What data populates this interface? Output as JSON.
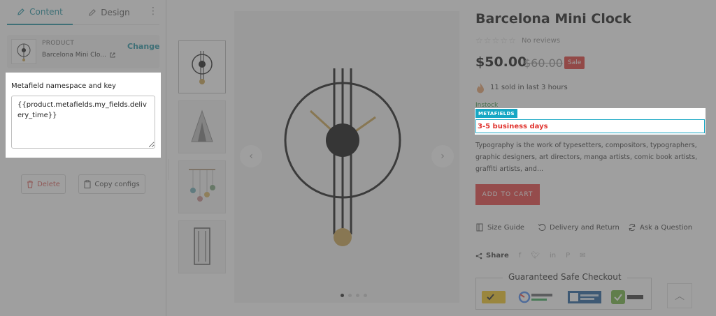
{
  "editor": {
    "tabs": [
      {
        "label": "Content",
        "active": true
      },
      {
        "label": "Design",
        "active": false
      }
    ],
    "more_icon": "more-vertical-icon",
    "product_card": {
      "caption": "PRODUCT",
      "name": "Barcelona Mini Clo...",
      "change_label": "Change"
    },
    "metafield": {
      "label": "Metafield namespace and key",
      "value": "{{product.metafields.my_fields.delivery_time}}"
    },
    "delete_label": "Delete",
    "copy_label": "Copy configs"
  },
  "product": {
    "title": "Barcelona Mini Clock",
    "reviews": "No reviews",
    "rating": 0,
    "rating_max": 5,
    "price": "$50.00",
    "compare_price": "$60.00",
    "sale_label": "Sale",
    "sold_text": "11 sold in last 3 hours",
    "stock_text": "Instock",
    "metafield_badge": "METAFIELDS",
    "metafield_value": "3-5 business days",
    "description": "Typography is the work of typesetters, compositors, typographers, graphic designers, art directors, manga artists, comic book artists, graffiti artists, and...",
    "add_to_cart": "ADD TO CART",
    "size_guide": "Size Guide",
    "delivery_return": "Delivery and Return",
    "ask_question": "Ask a Question",
    "share_label": "Share",
    "safe_checkout": "Guaranteed Safe Checkout",
    "gallery_slide": 1,
    "gallery_slides": 4
  },
  "colors": {
    "accent": "#1b8fa0",
    "sale": "#e0332e",
    "metafield_badge": "#17a7c4",
    "add_to_cart": "#e8393a"
  }
}
